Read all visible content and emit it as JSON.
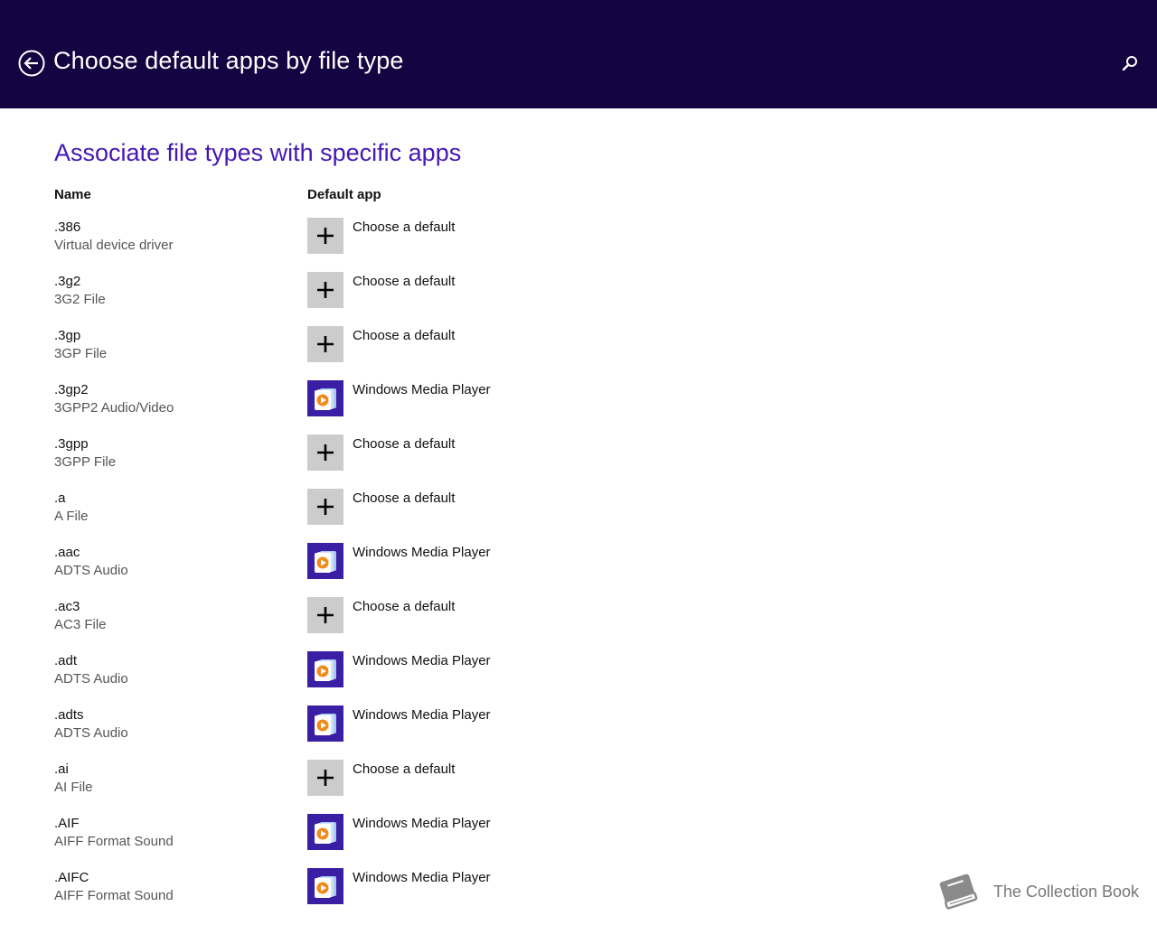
{
  "header": {
    "title": "Choose default apps by file type",
    "back_icon": "back-arrow-icon",
    "search_icon": "search-icon"
  },
  "section": {
    "title": "Associate file types with specific apps"
  },
  "columns": {
    "name": "Name",
    "default_app": "Default app"
  },
  "rows": [
    {
      "ext": ".386",
      "desc": "Virtual device driver",
      "app": "Choose a default",
      "icon": "plus-icon"
    },
    {
      "ext": ".3g2",
      "desc": "3G2 File",
      "app": "Choose a default",
      "icon": "plus-icon"
    },
    {
      "ext": ".3gp",
      "desc": "3GP File",
      "app": "Choose a default",
      "icon": "plus-icon"
    },
    {
      "ext": ".3gp2",
      "desc": "3GPP2 Audio/Video",
      "app": "Windows Media Player",
      "icon": "windows-media-player-icon"
    },
    {
      "ext": ".3gpp",
      "desc": "3GPP File",
      "app": "Choose a default",
      "icon": "plus-icon"
    },
    {
      "ext": ".a",
      "desc": "A File",
      "app": "Choose a default",
      "icon": "plus-icon"
    },
    {
      "ext": ".aac",
      "desc": "ADTS Audio",
      "app": "Windows Media Player",
      "icon": "windows-media-player-icon"
    },
    {
      "ext": ".ac3",
      "desc": "AC3 File",
      "app": "Choose a default",
      "icon": "plus-icon"
    },
    {
      "ext": ".adt",
      "desc": "ADTS Audio",
      "app": "Windows Media Player",
      "icon": "windows-media-player-icon"
    },
    {
      "ext": ".adts",
      "desc": "ADTS Audio",
      "app": "Windows Media Player",
      "icon": "windows-media-player-icon"
    },
    {
      "ext": ".ai",
      "desc": "AI File",
      "app": "Choose a default",
      "icon": "plus-icon"
    },
    {
      "ext": ".AIF",
      "desc": "AIFF Format Sound",
      "app": "Windows Media Player",
      "icon": "windows-media-player-icon"
    },
    {
      "ext": ".AIFC",
      "desc": "AIFF Format Sound",
      "app": "Windows Media Player",
      "icon": "windows-media-player-icon"
    }
  ],
  "watermark": {
    "text": "The Collection Book",
    "icon": "book-icon"
  },
  "colors": {
    "header_bg": "#140441",
    "accent": "#4617b4",
    "wmp_tile": "#3a1fa5",
    "plus_tile": "#cccccc"
  }
}
